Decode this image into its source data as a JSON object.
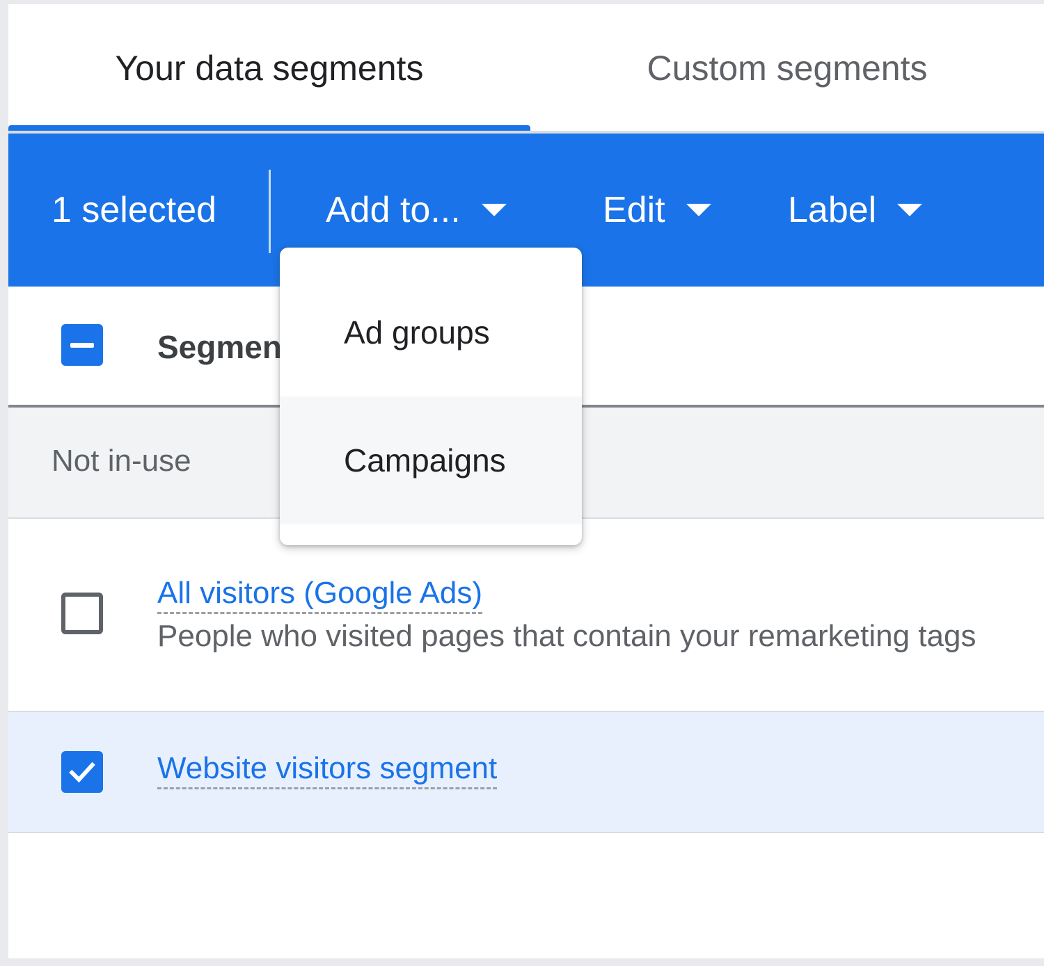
{
  "tabs": [
    {
      "label": "Your data segments",
      "active": true
    },
    {
      "label": "Custom segments",
      "active": false
    }
  ],
  "action_bar": {
    "selected_count": "1 selected",
    "add_to_label": "Add to...",
    "edit_label": "Edit",
    "label_label": "Label"
  },
  "table": {
    "column_header": "Segment",
    "group_label": "Not in-use",
    "rows": [
      {
        "name": "All visitors (Google Ads)",
        "description": "People who visited pages that contain your remarketing tags",
        "checked": false
      },
      {
        "name": "Website visitors segment",
        "description": "",
        "checked": true
      }
    ]
  },
  "add_to_menu": {
    "items": [
      {
        "label": "Ad groups"
      },
      {
        "label": "Campaigns",
        "hovered": true
      }
    ]
  },
  "colors": {
    "accent": "#1a73e8",
    "selected_row_bg": "#e8f0fe",
    "group_row_bg": "#f1f3f4"
  },
  "icons": {
    "dropdown": "caret-down-icon",
    "checkbox_indeterminate": "checkbox-indeterminate-icon",
    "checkbox_checked": "checkmark-icon",
    "checkbox_empty": "checkbox-unchecked-icon"
  }
}
